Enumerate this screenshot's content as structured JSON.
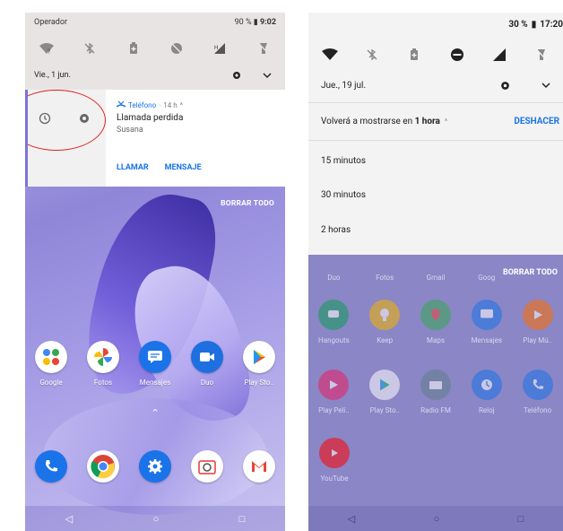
{
  "left": {
    "status": {
      "carrier": "Operador",
      "battery": "90 %",
      "time": "9:02"
    },
    "date": "Vie., 1 jun.",
    "notification": {
      "app": "Teléfono",
      "time": "14 h",
      "title": "Llamada perdida",
      "subtitle": "Susana",
      "action_call": "LLAMAR",
      "action_message": "MENSAJE"
    },
    "clear_all": "BORRAR TODO",
    "apps_row1": [
      {
        "label": "Google",
        "icon": "google-folder-icon",
        "color": "#ffffff"
      },
      {
        "label": "Fotos",
        "icon": "photos-icon",
        "color": "#ffffff"
      },
      {
        "label": "Mensajes",
        "icon": "messages-icon",
        "color": "#1a73e8"
      },
      {
        "label": "Duo",
        "icon": "duo-icon",
        "color": "#1e6fe0"
      },
      {
        "label": "Play Sto..",
        "icon": "play-store-icon",
        "color": "#ffffff"
      }
    ],
    "apps_row2": [
      {
        "icon": "phone-icon",
        "color": "#1a73e8"
      },
      {
        "icon": "chrome-icon",
        "color": "#ffffff"
      },
      {
        "icon": "settings-icon",
        "color": "#1a73e8"
      },
      {
        "icon": "camera-icon",
        "color": "#ffffff"
      },
      {
        "icon": "gmail-icon",
        "color": "#ffffff"
      }
    ]
  },
  "right": {
    "status": {
      "battery": "30 %",
      "time": "17:20"
    },
    "date": "Jue., 19 jul.",
    "snooze": {
      "prefix": "Volverá a mostrarse en",
      "duration": "1 hora",
      "undo": "DESHACER",
      "options": [
        "15 minutos",
        "30 minutos",
        "2 horas"
      ]
    },
    "clear_all": "BORRAR TODO",
    "row0_labels": [
      "Duo",
      "Fotos",
      "Gmail",
      "Goog"
    ],
    "row1": [
      {
        "label": "Hangouts",
        "color": "#0f9d58"
      },
      {
        "label": "Keep",
        "color": "#f4b400"
      },
      {
        "label": "Maps",
        "color": "#34a853"
      },
      {
        "label": "Mensajes",
        "color": "#1a73e8"
      },
      {
        "label": "Play Mú..",
        "color": "#ff6d00"
      }
    ],
    "row2": [
      {
        "label": "Play Pelí..",
        "color": "#e91e63"
      },
      {
        "label": "Play Sto..",
        "color": "#ffffff"
      },
      {
        "label": "Radio FM",
        "color": "#607d8b"
      },
      {
        "label": "Reloj",
        "color": "#1a73e8"
      },
      {
        "label": "Teléfono",
        "color": "#1a73e8"
      }
    ],
    "row3": [
      {
        "label": "YouTube",
        "color": "#ff0000"
      }
    ]
  }
}
